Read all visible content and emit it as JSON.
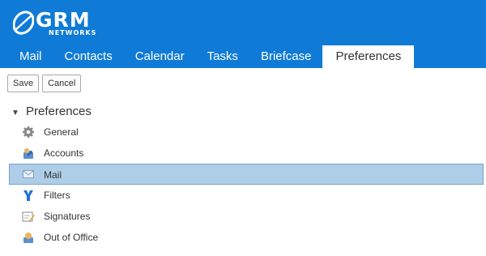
{
  "header": {
    "logo": {
      "name": "GRM",
      "sub": "NETWORKS"
    },
    "tabs": [
      {
        "label": "Mail"
      },
      {
        "label": "Contacts"
      },
      {
        "label": "Calendar"
      },
      {
        "label": "Tasks"
      },
      {
        "label": "Briefcase"
      },
      {
        "label": "Preferences",
        "active": true
      }
    ]
  },
  "toolbar": {
    "save_label": "Save",
    "cancel_label": "Cancel"
  },
  "tree": {
    "root_label": "Preferences",
    "items": [
      {
        "label": "General",
        "icon": "gear-icon"
      },
      {
        "label": "Accounts",
        "icon": "accounts-icon"
      },
      {
        "label": "Mail",
        "icon": "envelope-icon",
        "selected": true
      },
      {
        "label": "Filters",
        "icon": "filter-icon"
      },
      {
        "label": "Signatures",
        "icon": "signature-icon"
      },
      {
        "label": "Out of Office",
        "icon": "out-of-office-icon"
      }
    ]
  },
  "colors": {
    "header_bg": "#0f7bd6",
    "selected_bg": "#aecde8",
    "selected_border": "#7aa6cc"
  }
}
